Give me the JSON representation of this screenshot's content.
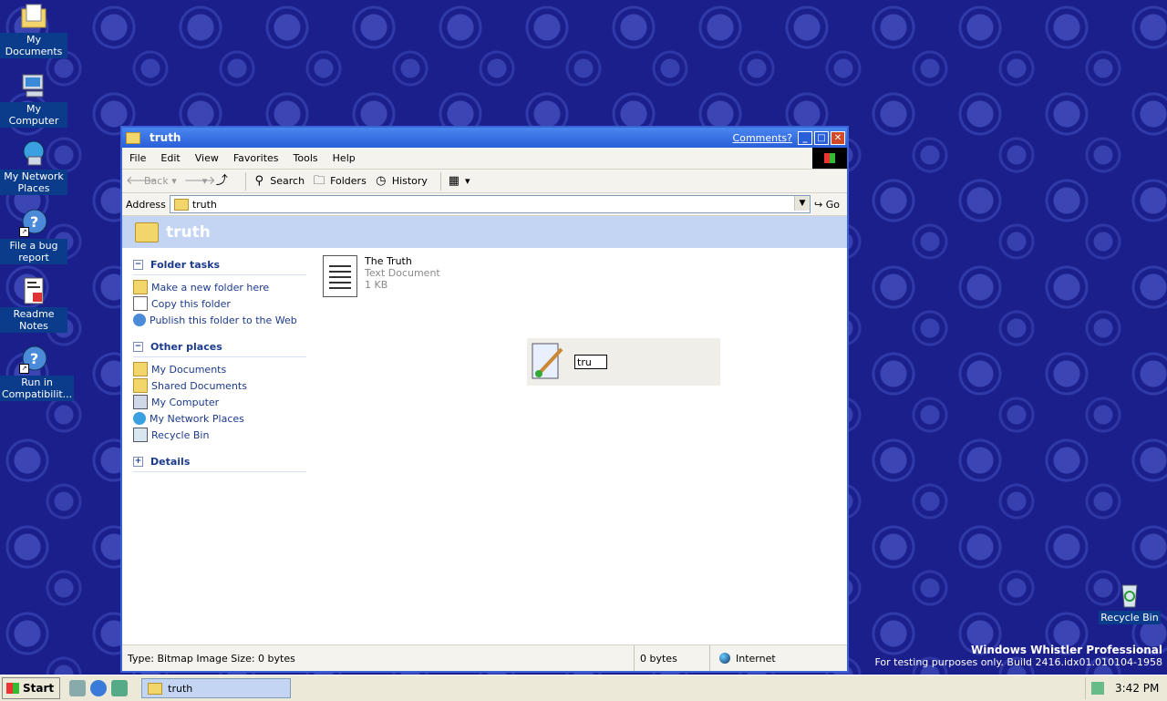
{
  "desktop": {
    "icons": [
      {
        "label": "My Documents"
      },
      {
        "label": "My Computer"
      },
      {
        "label": "My Network Places"
      },
      {
        "label": "File a bug report"
      },
      {
        "label": "Readme Notes"
      },
      {
        "label": "Run in Compatibilit..."
      }
    ],
    "recycle_bin": "Recycle Bin",
    "branding_line1": "Windows Whistler Professional",
    "branding_line2": "For testing purposes only. Build 2416.idx01.010104-1958"
  },
  "window": {
    "title": "truth",
    "comments_link": "Comments?",
    "menu": [
      "File",
      "Edit",
      "View",
      "Favorites",
      "Tools",
      "Help"
    ],
    "toolbar": {
      "back": "Back",
      "search": "Search",
      "folders": "Folders",
      "history": "History"
    },
    "address": {
      "label": "Address",
      "value": "truth",
      "go": "Go"
    },
    "banner_title": "truth",
    "folder_tasks": {
      "heading": "Folder tasks",
      "items": [
        "Make a new folder here",
        "Copy this folder",
        "Publish this folder to the Web"
      ]
    },
    "other_places": {
      "heading": "Other places",
      "items": [
        "My Documents",
        "Shared Documents",
        "My Computer",
        "My Network Places",
        "Recycle Bin"
      ]
    },
    "details": {
      "heading": "Details"
    },
    "file": {
      "name": "The Truth",
      "type": "Text Document",
      "size": "1 KB"
    },
    "rename_value": "tru",
    "status": {
      "type_info": "Type: Bitmap Image Size: 0 bytes",
      "bytes": "0 bytes",
      "zone": "Internet"
    }
  },
  "taskbar": {
    "start": "Start",
    "task_button": "truth",
    "clock": "3:42 PM"
  }
}
